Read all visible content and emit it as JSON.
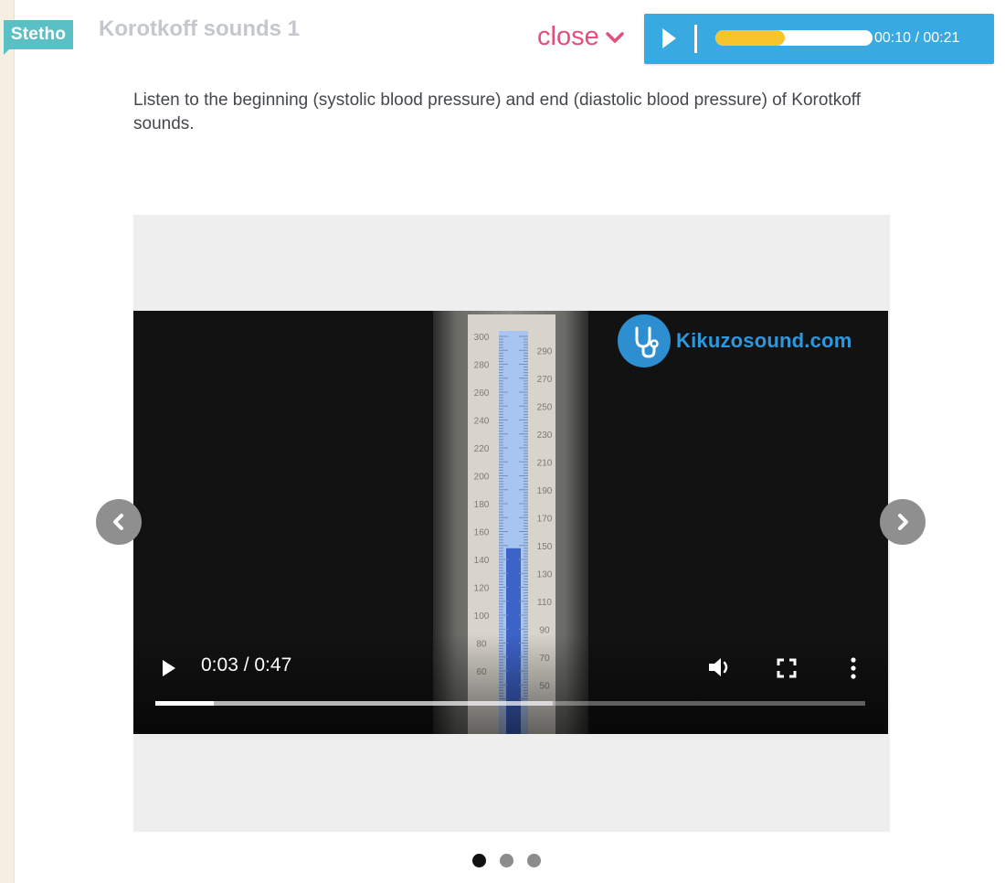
{
  "header": {
    "badge": "Stetho",
    "title": "Korotkoff sounds 1",
    "close_label": "close"
  },
  "audio_player": {
    "time_display": "00:10 / 00:21",
    "progress_fraction": 0.44
  },
  "description": "Listen to the beginning (systolic blood pressure) and end (diastolic blood pressure) of Korotkoff sounds.",
  "video": {
    "logo_text": "Kikuzosound.com",
    "time_display": "0:03 / 0:47",
    "progress_fraction": 0.083,
    "buffered_fraction": 0.56,
    "gauge_left_scale": [
      "300",
      "280",
      "260",
      "240",
      "220",
      "200",
      "180",
      "160",
      "140",
      "120",
      "100",
      "80",
      "60"
    ],
    "gauge_right_scale": [
      "290",
      "270",
      "250",
      "230",
      "210",
      "190",
      "170",
      "150",
      "130",
      "110",
      "90",
      "70",
      "50"
    ],
    "mercury_level_mmHg": 148
  },
  "carousel": {
    "slide_count": 3,
    "active_index": 0
  },
  "colors": {
    "badge": "#5bc0c6",
    "close": "#e34f7a",
    "audio_bar": "#39a9e2",
    "audio_fill": "#f6c52b",
    "logo": "#2d98de"
  }
}
